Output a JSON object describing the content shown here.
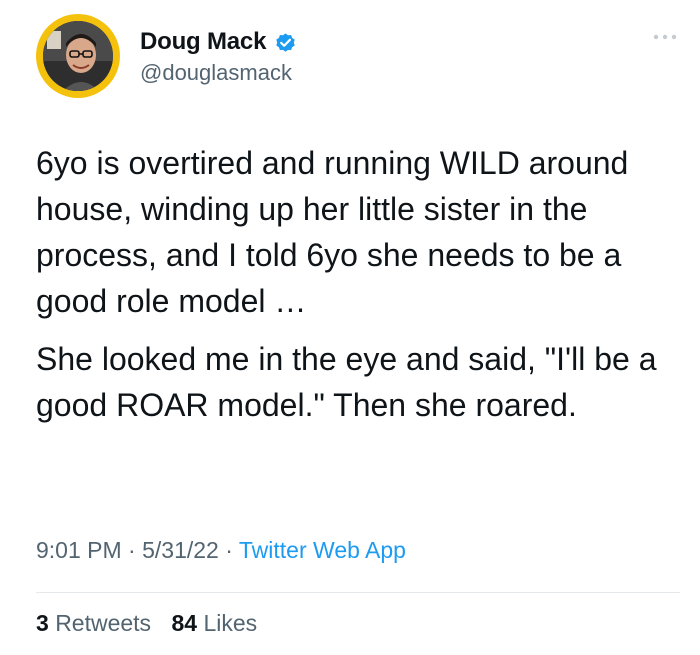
{
  "author": {
    "name": "Doug Mack",
    "handle": "@douglasmack",
    "verified": true
  },
  "tweet": {
    "paragraphs": [
      "6yo is overtired and running WILD around house, winding up her little sister in the process, and I told 6yo she needs to be a good role model …",
      "She looked me in the eye and said, \"I'll be a good ROAR model.\" Then she roared."
    ]
  },
  "meta": {
    "time": "9:01 PM",
    "separator": "·",
    "date": "5/31/22",
    "source": "Twitter Web App"
  },
  "stats": {
    "retweets_count": "3",
    "retweets_label": "Retweets",
    "likes_count": "84",
    "likes_label": "Likes"
  },
  "colors": {
    "avatar_ring": "#f4c20d",
    "verified_badge": "#1d9bf0",
    "link": "#1d9bf0",
    "secondary_text": "#536471",
    "primary_text": "#0f1419"
  },
  "icons": {
    "verified": "verified-badge-icon",
    "more": "more-horizontal-icon"
  }
}
